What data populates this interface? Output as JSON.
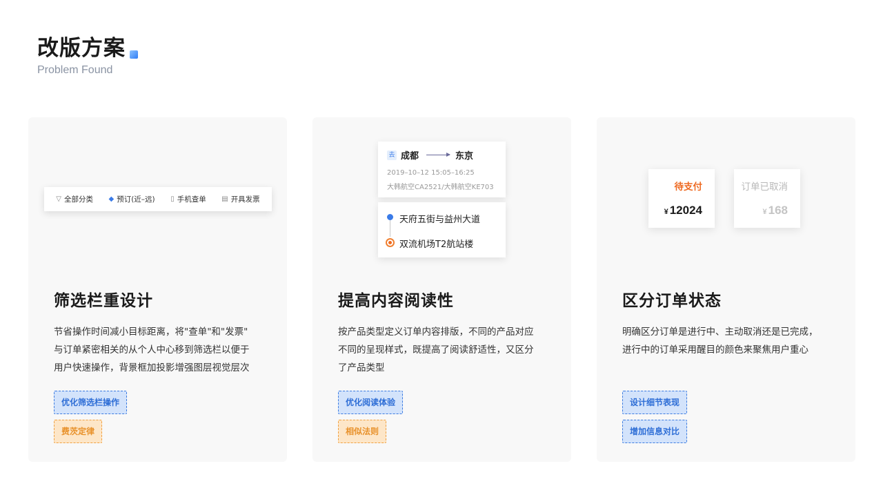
{
  "header": {
    "title": "改版方案",
    "subtitle": "Problem Found"
  },
  "colors": {
    "accent_blue": "#3a7be8",
    "accent_orange": "#ee6a22",
    "card_bg": "#f8f8f8"
  },
  "cards": [
    {
      "mock": {
        "filters": [
          {
            "icon": "filter-icon",
            "label": "全部分类"
          },
          {
            "icon": "diamond-icon",
            "label": "预订(近–远)"
          },
          {
            "icon": "bookmark-icon",
            "label": "手机查单"
          },
          {
            "icon": "invoice-icon",
            "label": "开具发票"
          }
        ]
      },
      "heading": "筛选栏重设计",
      "desc_lines": [
        "节省操作时间减小目标距离，将\"查单\"和\"发票\"",
        "与订单紧密相关的从个人中心移到筛选栏以便于",
        "用户快速操作，背景框加投影增强图层视觉层次"
      ],
      "tags": [
        "优化筛选栏操作",
        "费茨定律"
      ]
    },
    {
      "mock": {
        "badge": "去",
        "from": "成都",
        "to": "东京",
        "time": "2019–10–12 15:05–16:25",
        "flight": "大韩航空CA2521/大韩航空KE703",
        "route_start": "天府五街与益州大道",
        "route_end": "双流机场T2航站楼"
      },
      "heading": "提高内容阅读性",
      "desc_lines": [
        "按产品类型定义订单内容排版，不同的产品对应",
        "不同的呈现样式，既提高了阅读舒适性，又区分",
        "了产品类型"
      ],
      "tags": [
        "优化阅读体验",
        "相似法则"
      ]
    },
    {
      "mock": {
        "states": [
          {
            "label": "待支付",
            "currency": "¥",
            "amount": "12024"
          },
          {
            "label": "订单已取消",
            "currency": "¥",
            "amount": "168"
          }
        ]
      },
      "heading": "区分订单状态",
      "desc_lines": [
        "明确区分订单是进行中、主动取消还是已完成，",
        "进行中的订单采用醒目的颜色来聚焦用户重心"
      ],
      "tags": [
        "设计细节表现",
        "增加信息对比"
      ]
    }
  ]
}
